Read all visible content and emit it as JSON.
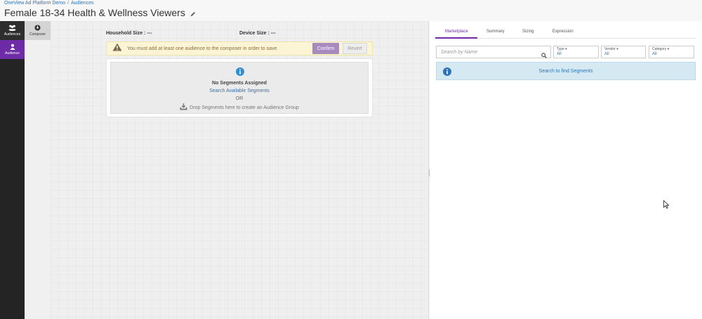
{
  "breadcrumb": {
    "items": [
      "OneView Ad Platform Demo",
      "Audiences"
    ],
    "separator": "/"
  },
  "page": {
    "title": "Female 18-34 Health & Wellness Viewers"
  },
  "rail": {
    "audiences_label": "Audiences",
    "audience_label": "Audience"
  },
  "composer": {
    "tab_label": "Composer",
    "household_size": "Household Size : ---",
    "device_size": "Device Size : ---",
    "warning": "You must add at least one audience to the composer in order to save.",
    "confirm_label": "Confirm",
    "revert_label": "Revert",
    "empty": {
      "title": "No Segments Assigned",
      "link": "Search Available Segments",
      "or": "OR",
      "drop_hint": "Drop Segments here to create an Audience Group"
    }
  },
  "panel": {
    "tabs": [
      "Marketplace",
      "Summary",
      "Sizing",
      "Expression"
    ],
    "search_placeholder": "Search by Name",
    "filters": [
      {
        "label": "Type ▾",
        "value": "All"
      },
      {
        "label": "Vendor ▾",
        "value": "All"
      },
      {
        "label": "Category ▾",
        "value": "All"
      }
    ],
    "banner": "Search to find Segments"
  },
  "colors": {
    "accent": "#6e2ba8",
    "link": "#2f73b7",
    "warning_bg": "#fbf5d6",
    "info_bg": "#d5e9f3"
  }
}
